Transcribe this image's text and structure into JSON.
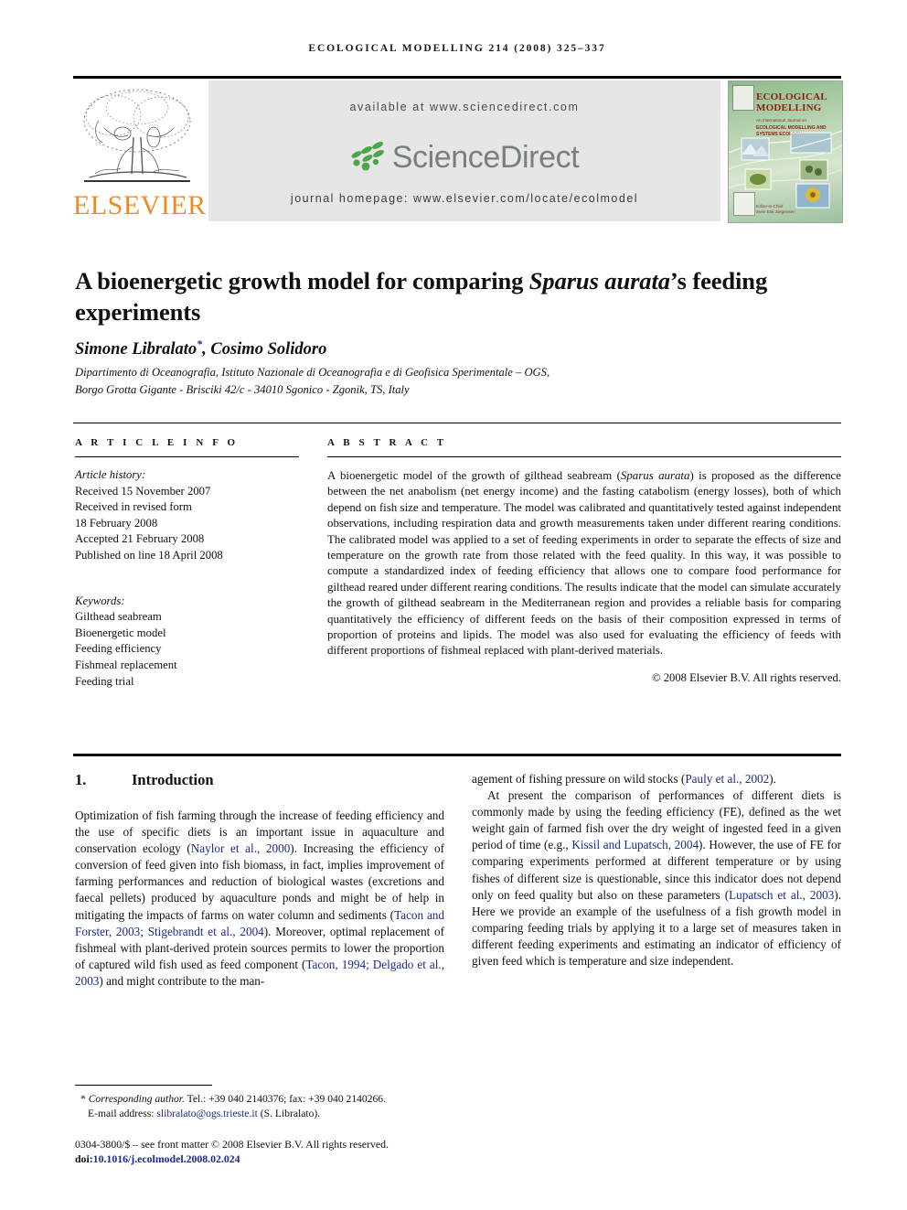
{
  "running_head": "ECOLOGICAL MODELLING 214 (2008) 325–337",
  "banner": {
    "publisher_wordmark": "ELSEVIER",
    "available_at": "available at www.sciencedirect.com",
    "sciencedirect_logo_text": "ScienceDirect",
    "journal_homepage": "journal homepage: www.elsevier.com/locate/ecolmodel",
    "accent_orange": "#F08A1E",
    "accent_green": "#4CA548",
    "logo_grey": "#77807D",
    "panel_grey": "#E6E6E6"
  },
  "cover": {
    "title_line1": "ECOLOGICAL",
    "title_line2": "MODELLING",
    "subtitle": "An International Journal on",
    "subtitle2": "ECOLOGICAL MODELLING AND SYSTEMS ECOLOGY",
    "editor_line1": "Editor-in-Chief",
    "editor_line2": "Sven Erik Jørgensen",
    "cover_title_color": "#8C1F10"
  },
  "article": {
    "title_part1": "A bioenergetic growth model for comparing ",
    "title_italic": "Sparus aurata",
    "title_part2": "’s feeding experiments",
    "authors_text": "Simone Libralato",
    "authors_marker": "*",
    "authors_rest": ", Cosimo Solidoro",
    "affiliation_line1": "Dipartimento di Oceanografia, Istituto Nazionale di Oceanografia e di Geofisica Sperimentale – OGS,",
    "affiliation_line2": "Borgo Grotta Gigante - Brisciki 42/c - 34010 Sgonico - Zgonik, TS, Italy"
  },
  "info": {
    "heading": "A R T I C L E   I N F O",
    "history_label": "Article history:",
    "history": [
      "Received 15 November 2007",
      "Received in revised form",
      "18 February 2008",
      "Accepted 21 February 2008",
      "Published on line 18 April 2008"
    ],
    "keywords_label": "Keywords:",
    "keywords": [
      "Gilthead seabream",
      "Bioenergetic model",
      "Feeding efficiency",
      "Fishmeal replacement",
      "Feeding trial"
    ]
  },
  "abstract": {
    "heading": "A B S T R A C T",
    "text_before_italic": "A bioenergetic model of the growth of gilthead seabream (",
    "species_italic": "Sparus aurata",
    "text_after_italic": ") is proposed as the difference between the net anabolism (net energy income) and the fasting catabolism (energy losses), both of which depend on fish size and temperature. The model was calibrated and quantitatively tested against independent observations, including respiration data and growth measurements taken under different rearing conditions. The calibrated model was applied to a set of feeding experiments in order to separate the effects of size and temperature on the growth rate from those related with the feed quality. In this way, it was possible to compute a standardized index of feeding efficiency that allows one to compare food performance for gilthead reared under different rearing conditions. The results indicate that the model can simulate accurately the growth of gilthead seabream in the Mediterranean region and provides a reliable basis for comparing quantitatively the efficiency of different feeds on the basis of their composition expressed in terms of proportion of proteins and lipids. The model was also used for evaluating the efficiency of feeds with different proportions of fishmeal replaced with plant-derived materials.",
    "copyright": "© 2008 Elsevier B.V. All rights reserved."
  },
  "body": {
    "section_number": "1.",
    "section_title": "Introduction",
    "left_para1_a": "Optimization of fish farming through the increase of feeding efficiency and the use of specific diets is an important issue in aquaculture and conservation ecology (",
    "left_cite1": "Naylor et al., 2000",
    "left_para1_b": "). Increasing the efficiency of conversion of feed given into fish biomass, in fact, implies improvement of farming performances and reduction of biological wastes (excretions and faecal pellets) produced by aquaculture ponds and might be of help in mitigating the impacts of farms on water column and sediments (",
    "left_cite2": "Tacon and Forster, 2003; Stigebrandt et al., 2004",
    "left_para1_c": "). Moreover, optimal replacement of fishmeal with plant-derived protein sources permits to lower the proportion of captured wild fish used as feed component (",
    "left_cite3": "Tacon, 1994; Delgado et al., 2003",
    "left_para1_d": ") and might contribute to the man-",
    "right_para1_a": "agement of fishing pressure on wild stocks (",
    "right_cite1": "Pauly et al., 2002",
    "right_para1_b": ").",
    "right_para2_a": "At present the comparison of performances of different diets is commonly made by using the feeding efficiency (FE), defined as the wet weight gain of farmed fish over the dry weight of ingested feed in a given period of time (e.g., ",
    "right_cite2": "Kissil and Lupatsch, 2004",
    "right_para2_b": "). However, the use of FE for comparing experiments performed at different temperature or by using fishes of different size is questionable, since this indicator does not depend only on feed quality but also on these parameters (",
    "right_cite3": "Lupatsch et al., 2003",
    "right_para2_c": "). Here we provide an example of the usefulness of a fish growth model in comparing feeding trials by applying it to a large set of measures taken in different feeding experiments and estimating an indicator of efficiency of given feed which is temperature and size independent."
  },
  "footer": {
    "corresponding_marker": "*",
    "corresponding_label": "Corresponding author.",
    "corresponding_contact": " Tel.: +39 040 2140376; fax: +39 040 2140266.",
    "email_label": "E-mail address:",
    "email": "slibralato@ogs.trieste.it",
    "email_owner": "(S. Libralato).",
    "issn_line": "0304-3800/$ – see front matter © 2008 Elsevier B.V. All rights reserved.",
    "doi_label": "doi:",
    "doi_value": "10.1016/j.ecolmodel.2008.02.024",
    "link_color": "#1B2A8C"
  }
}
